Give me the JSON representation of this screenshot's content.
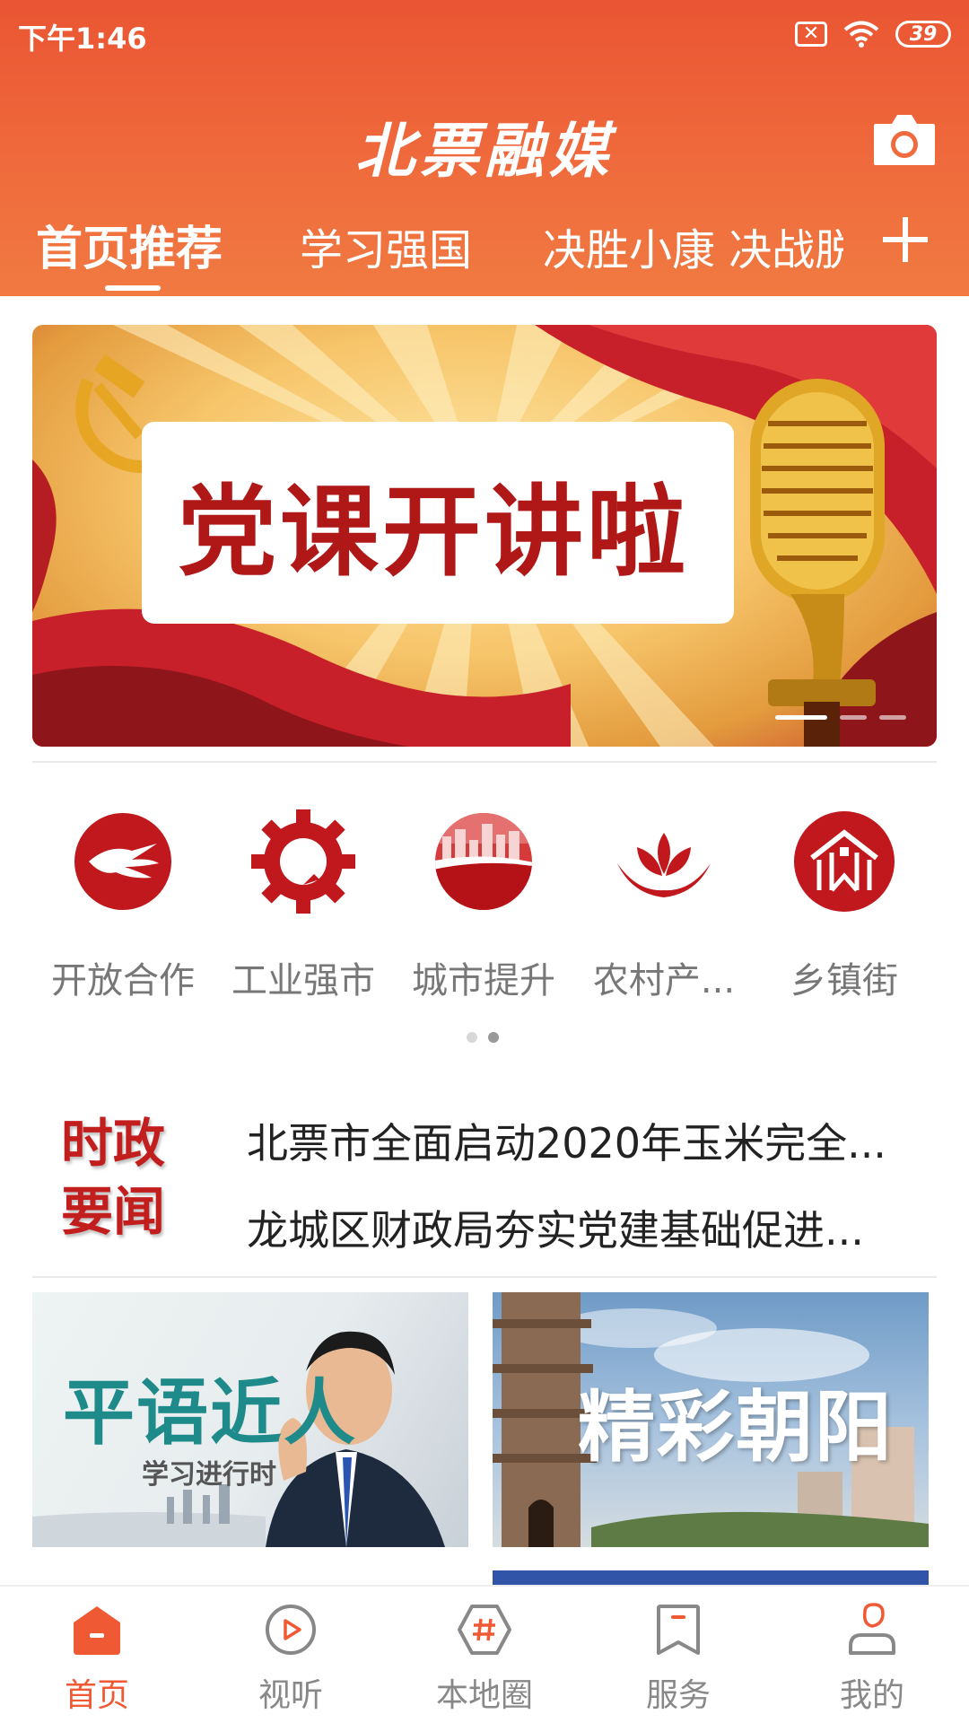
{
  "status_bar": {
    "time": "下午1:46",
    "battery": "39"
  },
  "app": {
    "title": "北票融媒"
  },
  "tabs": [
    {
      "label": "首页推荐",
      "active": true
    },
    {
      "label": "学习强国",
      "active": false
    },
    {
      "label": "决胜小康 决战脱",
      "active": false
    }
  ],
  "banner": {
    "text": "党课开讲啦",
    "slide_count": 3,
    "current_slide": 1
  },
  "categories": [
    {
      "label": "开放合作",
      "icon": "handshake-icon"
    },
    {
      "label": "工业强市",
      "icon": "gear-icon"
    },
    {
      "label": "城市提升",
      "icon": "city-icon"
    },
    {
      "label": "农村产...",
      "icon": "lotus-icon"
    },
    {
      "label": "乡镇街",
      "icon": "house-icon"
    }
  ],
  "category_pages": {
    "count": 2,
    "current": 2
  },
  "news": {
    "tag_line1": "时政",
    "tag_line2": "要闻",
    "items": [
      "北票市全面启动2020年玉米完全...",
      "龙城区财政局夯实党建基础促进..."
    ]
  },
  "thumbnails": [
    {
      "title": "平语近人",
      "subtitle": "学习进行时"
    },
    {
      "title": "精彩朝阳"
    }
  ],
  "bottom_nav": [
    {
      "label": "首页",
      "icon": "home-icon",
      "active": true
    },
    {
      "label": "视听",
      "icon": "play-icon",
      "active": false
    },
    {
      "label": "本地圈",
      "icon": "hashtag-icon",
      "active": false
    },
    {
      "label": "服务",
      "icon": "bookmark-icon",
      "active": false
    },
    {
      "label": "我的",
      "icon": "user-icon",
      "active": false
    }
  ],
  "colors": {
    "brand": "#ef5a35",
    "header": "#ea5533",
    "tag_red": "#c21e1e",
    "icon_red": "#c0181d"
  }
}
